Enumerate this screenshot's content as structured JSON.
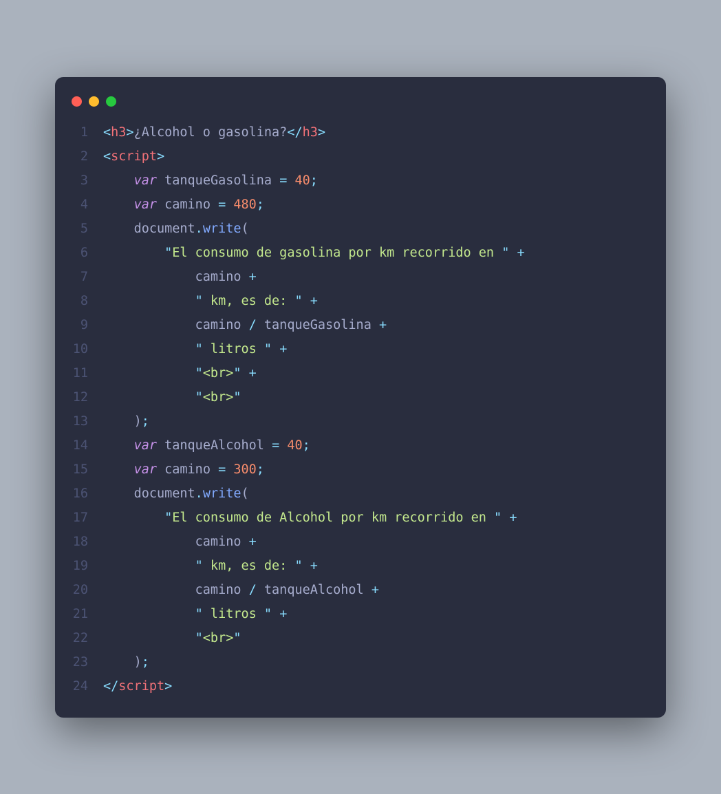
{
  "window": {
    "traffic_lights": [
      "close",
      "minimize",
      "zoom"
    ]
  },
  "code": {
    "lines": [
      {
        "n": 1,
        "tokens": [
          {
            "c": "punct",
            "t": "<"
          },
          {
            "c": "tag",
            "t": "h3"
          },
          {
            "c": "punct",
            "t": ">"
          },
          {
            "c": "text",
            "t": "¿Alcohol o gasolina?"
          },
          {
            "c": "punct",
            "t": "</"
          },
          {
            "c": "tag",
            "t": "h3"
          },
          {
            "c": "punct",
            "t": ">"
          }
        ]
      },
      {
        "n": 2,
        "tokens": [
          {
            "c": "punct",
            "t": "<"
          },
          {
            "c": "tag",
            "t": "script"
          },
          {
            "c": "punct",
            "t": ">"
          }
        ]
      },
      {
        "n": 3,
        "tokens": [
          {
            "c": "text",
            "t": "    "
          },
          {
            "c": "kw",
            "t": "var"
          },
          {
            "c": "text",
            "t": " "
          },
          {
            "c": "ident",
            "t": "tanqueGasolina"
          },
          {
            "c": "text",
            "t": " "
          },
          {
            "c": "op",
            "t": "="
          },
          {
            "c": "text",
            "t": " "
          },
          {
            "c": "num",
            "t": "40"
          },
          {
            "c": "del",
            "t": ";"
          }
        ]
      },
      {
        "n": 4,
        "tokens": [
          {
            "c": "text",
            "t": "    "
          },
          {
            "c": "kw",
            "t": "var"
          },
          {
            "c": "text",
            "t": " "
          },
          {
            "c": "ident",
            "t": "camino"
          },
          {
            "c": "text",
            "t": " "
          },
          {
            "c": "op",
            "t": "="
          },
          {
            "c": "text",
            "t": " "
          },
          {
            "c": "num",
            "t": "480"
          },
          {
            "c": "del",
            "t": ";"
          }
        ]
      },
      {
        "n": 5,
        "tokens": [
          {
            "c": "text",
            "t": "    "
          },
          {
            "c": "obj",
            "t": "document"
          },
          {
            "c": "del",
            "t": "."
          },
          {
            "c": "method",
            "t": "write"
          },
          {
            "c": "paren",
            "t": "("
          }
        ]
      },
      {
        "n": 6,
        "tokens": [
          {
            "c": "text",
            "t": "        "
          },
          {
            "c": "del",
            "t": "\""
          },
          {
            "c": "str",
            "t": "El consumo de gasolina por km recorrido en "
          },
          {
            "c": "del",
            "t": "\""
          },
          {
            "c": "text",
            "t": " "
          },
          {
            "c": "op",
            "t": "+"
          }
        ]
      },
      {
        "n": 7,
        "tokens": [
          {
            "c": "text",
            "t": "            "
          },
          {
            "c": "ident",
            "t": "camino"
          },
          {
            "c": "text",
            "t": " "
          },
          {
            "c": "op",
            "t": "+"
          }
        ]
      },
      {
        "n": 8,
        "tokens": [
          {
            "c": "text",
            "t": "            "
          },
          {
            "c": "del",
            "t": "\""
          },
          {
            "c": "str",
            "t": " km, es de: "
          },
          {
            "c": "del",
            "t": "\""
          },
          {
            "c": "text",
            "t": " "
          },
          {
            "c": "op",
            "t": "+"
          }
        ]
      },
      {
        "n": 9,
        "tokens": [
          {
            "c": "text",
            "t": "            "
          },
          {
            "c": "ident",
            "t": "camino"
          },
          {
            "c": "text",
            "t": " "
          },
          {
            "c": "op",
            "t": "/"
          },
          {
            "c": "text",
            "t": " "
          },
          {
            "c": "ident",
            "t": "tanqueGasolina"
          },
          {
            "c": "text",
            "t": " "
          },
          {
            "c": "op",
            "t": "+"
          }
        ]
      },
      {
        "n": 10,
        "tokens": [
          {
            "c": "text",
            "t": "            "
          },
          {
            "c": "del",
            "t": "\""
          },
          {
            "c": "str",
            "t": " litros "
          },
          {
            "c": "del",
            "t": "\""
          },
          {
            "c": "text",
            "t": " "
          },
          {
            "c": "op",
            "t": "+"
          }
        ]
      },
      {
        "n": 11,
        "tokens": [
          {
            "c": "text",
            "t": "            "
          },
          {
            "c": "del",
            "t": "\""
          },
          {
            "c": "str",
            "t": "<br>"
          },
          {
            "c": "del",
            "t": "\""
          },
          {
            "c": "text",
            "t": " "
          },
          {
            "c": "op",
            "t": "+"
          }
        ]
      },
      {
        "n": 12,
        "tokens": [
          {
            "c": "text",
            "t": "            "
          },
          {
            "c": "del",
            "t": "\""
          },
          {
            "c": "str",
            "t": "<br>"
          },
          {
            "c": "del",
            "t": "\""
          }
        ]
      },
      {
        "n": 13,
        "tokens": [
          {
            "c": "text",
            "t": "    "
          },
          {
            "c": "paren",
            "t": ")"
          },
          {
            "c": "del",
            "t": ";"
          }
        ]
      },
      {
        "n": 14,
        "tokens": [
          {
            "c": "text",
            "t": "    "
          },
          {
            "c": "kw",
            "t": "var"
          },
          {
            "c": "text",
            "t": " "
          },
          {
            "c": "ident",
            "t": "tanqueAlcohol"
          },
          {
            "c": "text",
            "t": " "
          },
          {
            "c": "op",
            "t": "="
          },
          {
            "c": "text",
            "t": " "
          },
          {
            "c": "num",
            "t": "40"
          },
          {
            "c": "del",
            "t": ";"
          }
        ]
      },
      {
        "n": 15,
        "tokens": [
          {
            "c": "text",
            "t": "    "
          },
          {
            "c": "kw",
            "t": "var"
          },
          {
            "c": "text",
            "t": " "
          },
          {
            "c": "ident",
            "t": "camino"
          },
          {
            "c": "text",
            "t": " "
          },
          {
            "c": "op",
            "t": "="
          },
          {
            "c": "text",
            "t": " "
          },
          {
            "c": "num",
            "t": "300"
          },
          {
            "c": "del",
            "t": ";"
          }
        ]
      },
      {
        "n": 16,
        "tokens": [
          {
            "c": "text",
            "t": "    "
          },
          {
            "c": "obj",
            "t": "document"
          },
          {
            "c": "del",
            "t": "."
          },
          {
            "c": "method",
            "t": "write"
          },
          {
            "c": "paren",
            "t": "("
          }
        ]
      },
      {
        "n": 17,
        "tokens": [
          {
            "c": "text",
            "t": "        "
          },
          {
            "c": "del",
            "t": "\""
          },
          {
            "c": "str",
            "t": "El consumo de Alcohol por km recorrido en "
          },
          {
            "c": "del",
            "t": "\""
          },
          {
            "c": "text",
            "t": " "
          },
          {
            "c": "op",
            "t": "+"
          }
        ]
      },
      {
        "n": 18,
        "tokens": [
          {
            "c": "text",
            "t": "            "
          },
          {
            "c": "ident",
            "t": "camino"
          },
          {
            "c": "text",
            "t": " "
          },
          {
            "c": "op",
            "t": "+"
          }
        ]
      },
      {
        "n": 19,
        "tokens": [
          {
            "c": "text",
            "t": "            "
          },
          {
            "c": "del",
            "t": "\""
          },
          {
            "c": "str",
            "t": " km, es de: "
          },
          {
            "c": "del",
            "t": "\""
          },
          {
            "c": "text",
            "t": " "
          },
          {
            "c": "op",
            "t": "+"
          }
        ]
      },
      {
        "n": 20,
        "tokens": [
          {
            "c": "text",
            "t": "            "
          },
          {
            "c": "ident",
            "t": "camino"
          },
          {
            "c": "text",
            "t": " "
          },
          {
            "c": "op",
            "t": "/"
          },
          {
            "c": "text",
            "t": " "
          },
          {
            "c": "ident",
            "t": "tanqueAlcohol"
          },
          {
            "c": "text",
            "t": " "
          },
          {
            "c": "op",
            "t": "+"
          }
        ]
      },
      {
        "n": 21,
        "tokens": [
          {
            "c": "text",
            "t": "            "
          },
          {
            "c": "del",
            "t": "\""
          },
          {
            "c": "str",
            "t": " litros "
          },
          {
            "c": "del",
            "t": "\""
          },
          {
            "c": "text",
            "t": " "
          },
          {
            "c": "op",
            "t": "+"
          }
        ]
      },
      {
        "n": 22,
        "tokens": [
          {
            "c": "text",
            "t": "            "
          },
          {
            "c": "del",
            "t": "\""
          },
          {
            "c": "str",
            "t": "<br>"
          },
          {
            "c": "del",
            "t": "\""
          }
        ]
      },
      {
        "n": 23,
        "tokens": [
          {
            "c": "text",
            "t": "    "
          },
          {
            "c": "paren",
            "t": ")"
          },
          {
            "c": "del",
            "t": ";"
          }
        ]
      },
      {
        "n": 24,
        "tokens": [
          {
            "c": "punct",
            "t": "</"
          },
          {
            "c": "tag",
            "t": "script"
          },
          {
            "c": "punct",
            "t": ">"
          }
        ]
      }
    ]
  }
}
